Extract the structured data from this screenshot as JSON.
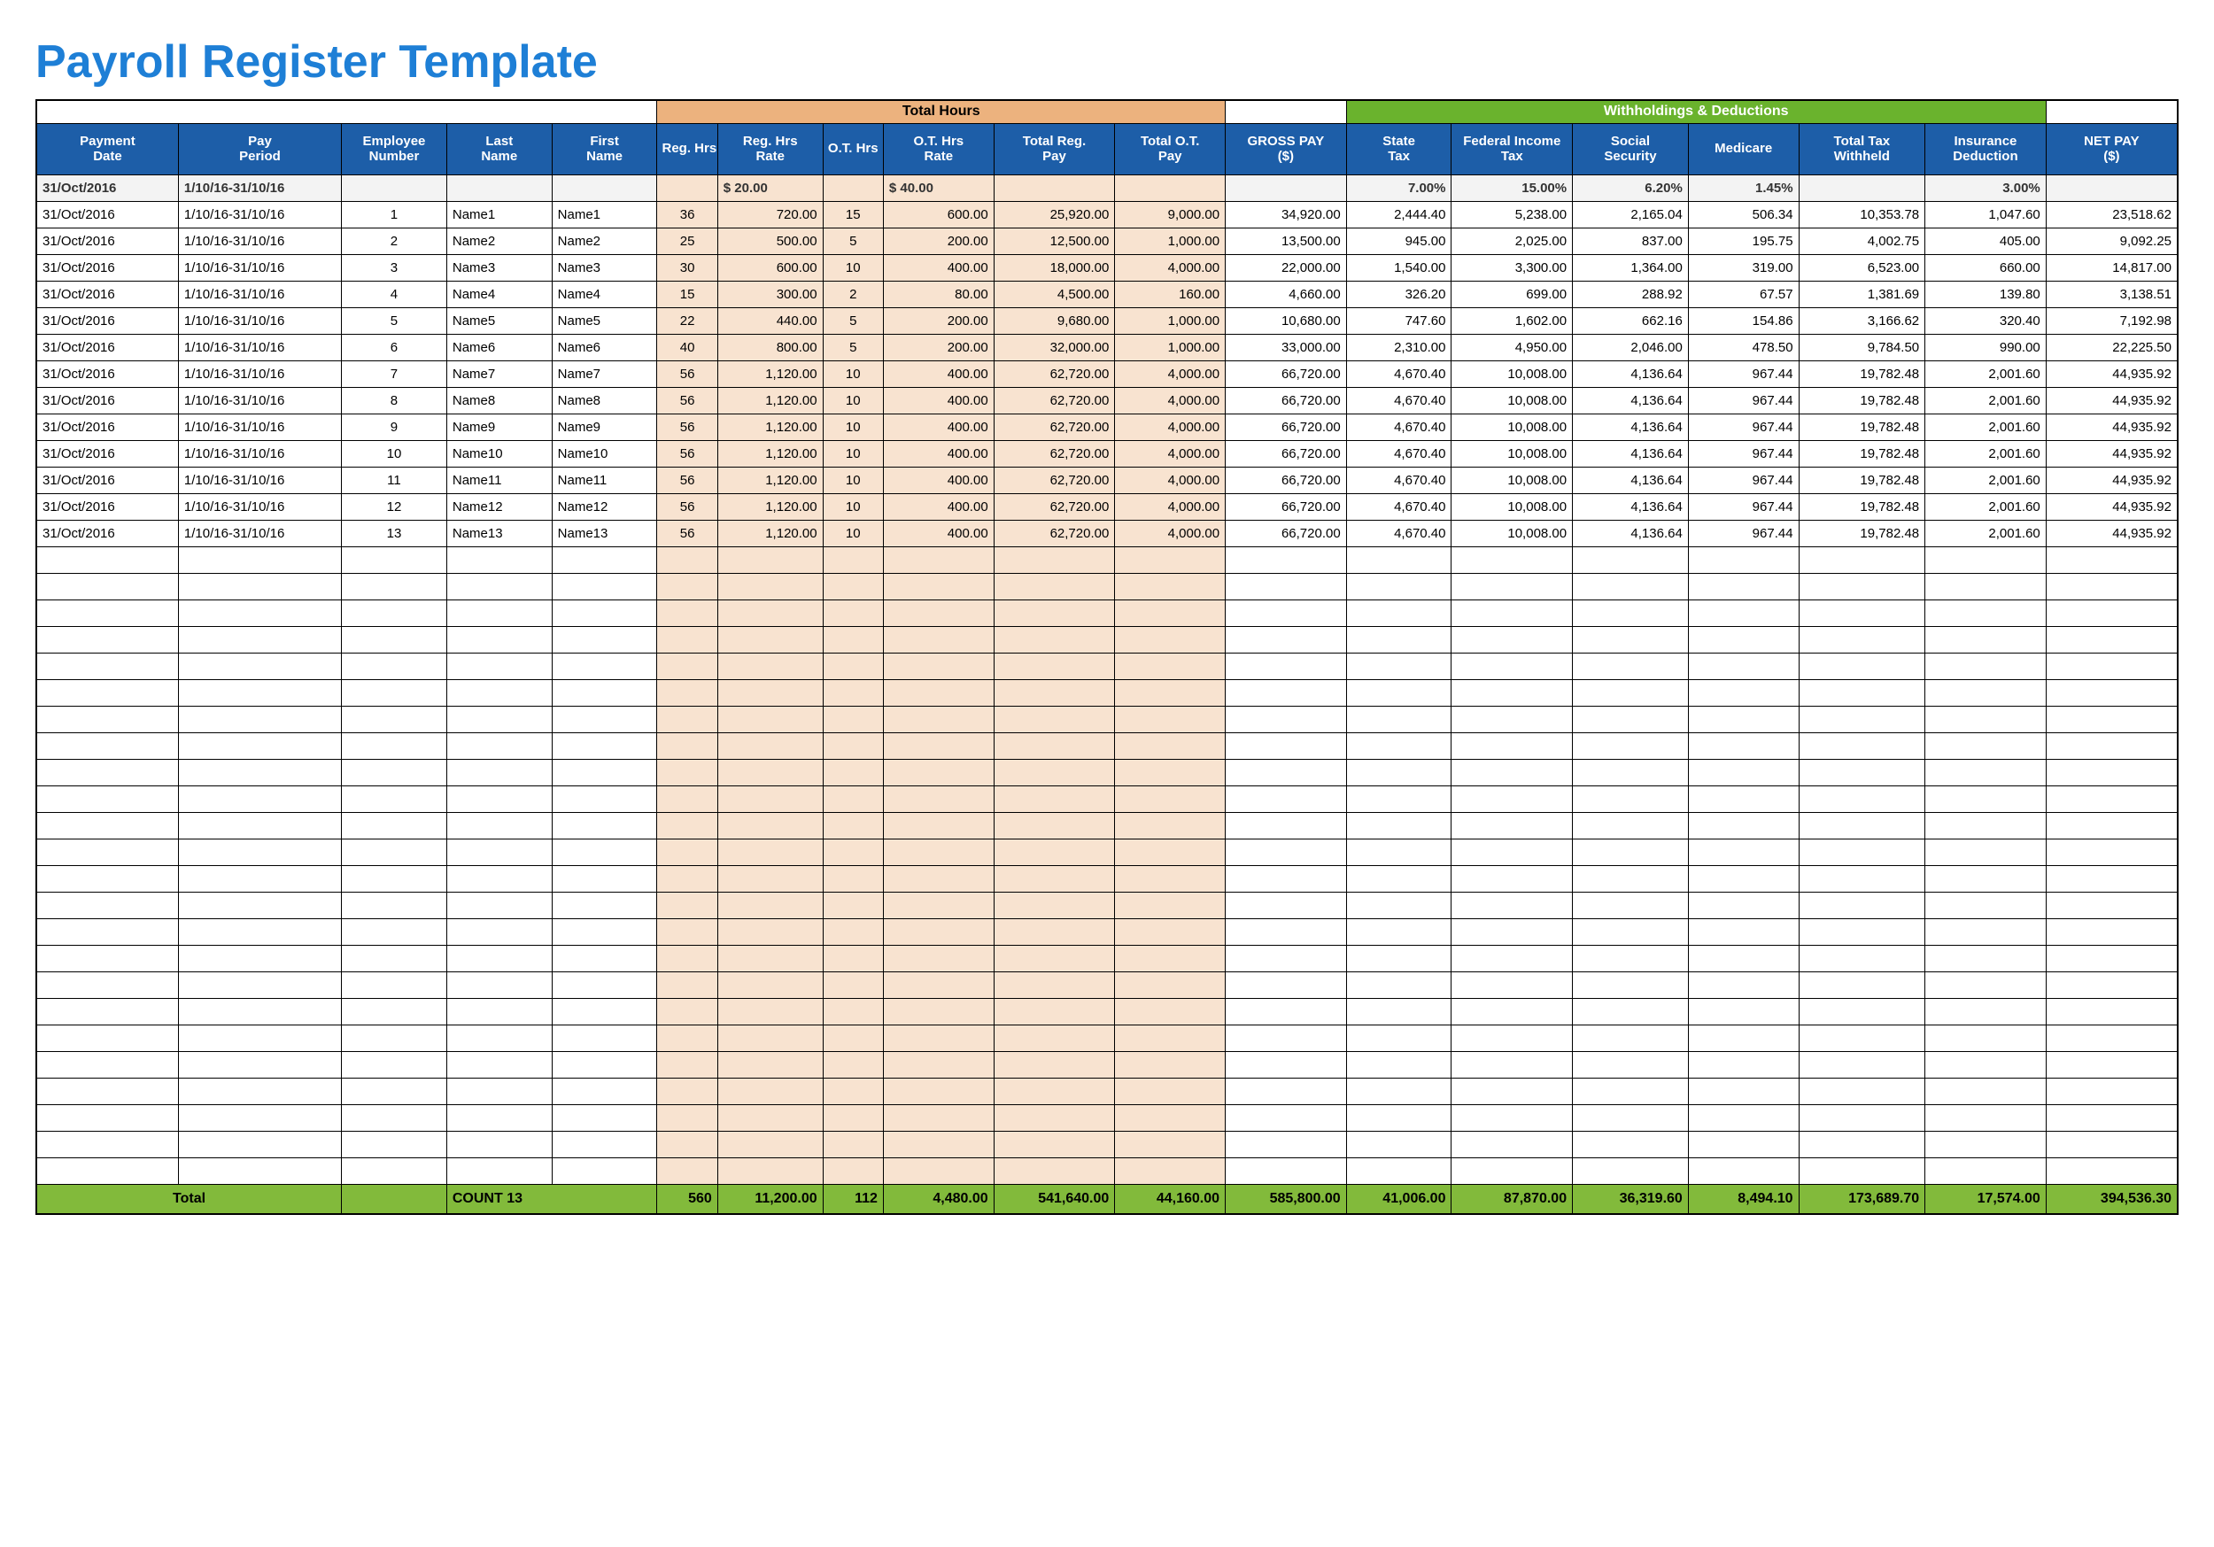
{
  "title": "Payroll Register Template",
  "groupHeaders": {
    "totalHours": "Total Hours",
    "withholdings": "Withholdings & Deductions"
  },
  "columns": [
    "Payment Date",
    "Pay Period",
    "Employee Number",
    "Last Name",
    "First Name",
    "Reg. Hrs",
    "Reg. Hrs Rate",
    "O.T. Hrs",
    "O.T. Hrs Rate",
    "Total Reg. Pay",
    "Total O.T. Pay",
    "GROSS PAY ($)",
    "State Tax",
    "Federal Income Tax",
    "Social Security",
    "Medicare",
    "Total Tax Withheld",
    "Insurance Deduction",
    "NET PAY ($)"
  ],
  "rateRow": {
    "payment_date": "31/Oct/2016",
    "pay_period": "1/10/16-31/10/16",
    "reg_rate": "$       20.00",
    "ot_rate": "$       40.00",
    "state_tax": "7.00%",
    "fed_tax": "15.00%",
    "ss": "6.20%",
    "medicare": "1.45%",
    "insurance": "3.00%"
  },
  "rows": [
    {
      "payment_date": "31/Oct/2016",
      "pay_period": "1/10/16-31/10/16",
      "emp": "1",
      "last": "Name1",
      "first": "Name1",
      "rh": "36",
      "rhr": "720.00",
      "oth": "15",
      "otr": "600.00",
      "trp": "25,920.00",
      "top": "9,000.00",
      "gross": "34,920.00",
      "stax": "2,444.40",
      "ftax": "5,238.00",
      "ss": "2,165.04",
      "med": "506.34",
      "twh": "10,353.78",
      "ins": "1,047.60",
      "net": "23,518.62"
    },
    {
      "payment_date": "31/Oct/2016",
      "pay_period": "1/10/16-31/10/16",
      "emp": "2",
      "last": "Name2",
      "first": "Name2",
      "rh": "25",
      "rhr": "500.00",
      "oth": "5",
      "otr": "200.00",
      "trp": "12,500.00",
      "top": "1,000.00",
      "gross": "13,500.00",
      "stax": "945.00",
      "ftax": "2,025.00",
      "ss": "837.00",
      "med": "195.75",
      "twh": "4,002.75",
      "ins": "405.00",
      "net": "9,092.25"
    },
    {
      "payment_date": "31/Oct/2016",
      "pay_period": "1/10/16-31/10/16",
      "emp": "3",
      "last": "Name3",
      "first": "Name3",
      "rh": "30",
      "rhr": "600.00",
      "oth": "10",
      "otr": "400.00",
      "trp": "18,000.00",
      "top": "4,000.00",
      "gross": "22,000.00",
      "stax": "1,540.00",
      "ftax": "3,300.00",
      "ss": "1,364.00",
      "med": "319.00",
      "twh": "6,523.00",
      "ins": "660.00",
      "net": "14,817.00"
    },
    {
      "payment_date": "31/Oct/2016",
      "pay_period": "1/10/16-31/10/16",
      "emp": "4",
      "last": "Name4",
      "first": "Name4",
      "rh": "15",
      "rhr": "300.00",
      "oth": "2",
      "otr": "80.00",
      "trp": "4,500.00",
      "top": "160.00",
      "gross": "4,660.00",
      "stax": "326.20",
      "ftax": "699.00",
      "ss": "288.92",
      "med": "67.57",
      "twh": "1,381.69",
      "ins": "139.80",
      "net": "3,138.51"
    },
    {
      "payment_date": "31/Oct/2016",
      "pay_period": "1/10/16-31/10/16",
      "emp": "5",
      "last": "Name5",
      "first": "Name5",
      "rh": "22",
      "rhr": "440.00",
      "oth": "5",
      "otr": "200.00",
      "trp": "9,680.00",
      "top": "1,000.00",
      "gross": "10,680.00",
      "stax": "747.60",
      "ftax": "1,602.00",
      "ss": "662.16",
      "med": "154.86",
      "twh": "3,166.62",
      "ins": "320.40",
      "net": "7,192.98"
    },
    {
      "payment_date": "31/Oct/2016",
      "pay_period": "1/10/16-31/10/16",
      "emp": "6",
      "last": "Name6",
      "first": "Name6",
      "rh": "40",
      "rhr": "800.00",
      "oth": "5",
      "otr": "200.00",
      "trp": "32,000.00",
      "top": "1,000.00",
      "gross": "33,000.00",
      "stax": "2,310.00",
      "ftax": "4,950.00",
      "ss": "2,046.00",
      "med": "478.50",
      "twh": "9,784.50",
      "ins": "990.00",
      "net": "22,225.50"
    },
    {
      "payment_date": "31/Oct/2016",
      "pay_period": "1/10/16-31/10/16",
      "emp": "7",
      "last": "Name7",
      "first": "Name7",
      "rh": "56",
      "rhr": "1,120.00",
      "oth": "10",
      "otr": "400.00",
      "trp": "62,720.00",
      "top": "4,000.00",
      "gross": "66,720.00",
      "stax": "4,670.40",
      "ftax": "10,008.00",
      "ss": "4,136.64",
      "med": "967.44",
      "twh": "19,782.48",
      "ins": "2,001.60",
      "net": "44,935.92"
    },
    {
      "payment_date": "31/Oct/2016",
      "pay_period": "1/10/16-31/10/16",
      "emp": "8",
      "last": "Name8",
      "first": "Name8",
      "rh": "56",
      "rhr": "1,120.00",
      "oth": "10",
      "otr": "400.00",
      "trp": "62,720.00",
      "top": "4,000.00",
      "gross": "66,720.00",
      "stax": "4,670.40",
      "ftax": "10,008.00",
      "ss": "4,136.64",
      "med": "967.44",
      "twh": "19,782.48",
      "ins": "2,001.60",
      "net": "44,935.92"
    },
    {
      "payment_date": "31/Oct/2016",
      "pay_period": "1/10/16-31/10/16",
      "emp": "9",
      "last": "Name9",
      "first": "Name9",
      "rh": "56",
      "rhr": "1,120.00",
      "oth": "10",
      "otr": "400.00",
      "trp": "62,720.00",
      "top": "4,000.00",
      "gross": "66,720.00",
      "stax": "4,670.40",
      "ftax": "10,008.00",
      "ss": "4,136.64",
      "med": "967.44",
      "twh": "19,782.48",
      "ins": "2,001.60",
      "net": "44,935.92"
    },
    {
      "payment_date": "31/Oct/2016",
      "pay_period": "1/10/16-31/10/16",
      "emp": "10",
      "last": "Name10",
      "first": "Name10",
      "rh": "56",
      "rhr": "1,120.00",
      "oth": "10",
      "otr": "400.00",
      "trp": "62,720.00",
      "top": "4,000.00",
      "gross": "66,720.00",
      "stax": "4,670.40",
      "ftax": "10,008.00",
      "ss": "4,136.64",
      "med": "967.44",
      "twh": "19,782.48",
      "ins": "2,001.60",
      "net": "44,935.92"
    },
    {
      "payment_date": "31/Oct/2016",
      "pay_period": "1/10/16-31/10/16",
      "emp": "11",
      "last": "Name11",
      "first": "Name11",
      "rh": "56",
      "rhr": "1,120.00",
      "oth": "10",
      "otr": "400.00",
      "trp": "62,720.00",
      "top": "4,000.00",
      "gross": "66,720.00",
      "stax": "4,670.40",
      "ftax": "10,008.00",
      "ss": "4,136.64",
      "med": "967.44",
      "twh": "19,782.48",
      "ins": "2,001.60",
      "net": "44,935.92"
    },
    {
      "payment_date": "31/Oct/2016",
      "pay_period": "1/10/16-31/10/16",
      "emp": "12",
      "last": "Name12",
      "first": "Name12",
      "rh": "56",
      "rhr": "1,120.00",
      "oth": "10",
      "otr": "400.00",
      "trp": "62,720.00",
      "top": "4,000.00",
      "gross": "66,720.00",
      "stax": "4,670.40",
      "ftax": "10,008.00",
      "ss": "4,136.64",
      "med": "967.44",
      "twh": "19,782.48",
      "ins": "2,001.60",
      "net": "44,935.92"
    },
    {
      "payment_date": "31/Oct/2016",
      "pay_period": "1/10/16-31/10/16",
      "emp": "13",
      "last": "Name13",
      "first": "Name13",
      "rh": "56",
      "rhr": "1,120.00",
      "oth": "10",
      "otr": "400.00",
      "trp": "62,720.00",
      "top": "4,000.00",
      "gross": "66,720.00",
      "stax": "4,670.40",
      "ftax": "10,008.00",
      "ss": "4,136.64",
      "med": "967.44",
      "twh": "19,782.48",
      "ins": "2,001.60",
      "net": "44,935.92"
    }
  ],
  "emptyRowCount": 24,
  "totals": {
    "label": "Total",
    "count_label": "COUNT  13",
    "rh": "560",
    "rhr": "11,200.00",
    "oth": "112",
    "otr": "4,480.00",
    "trp": "541,640.00",
    "top": "44,160.00",
    "gross": "585,800.00",
    "stax": "41,006.00",
    "ftax": "87,870.00",
    "ss": "36,319.60",
    "med": "8,494.10",
    "twh": "173,689.70",
    "ins": "17,574.00",
    "net": "394,536.30"
  }
}
